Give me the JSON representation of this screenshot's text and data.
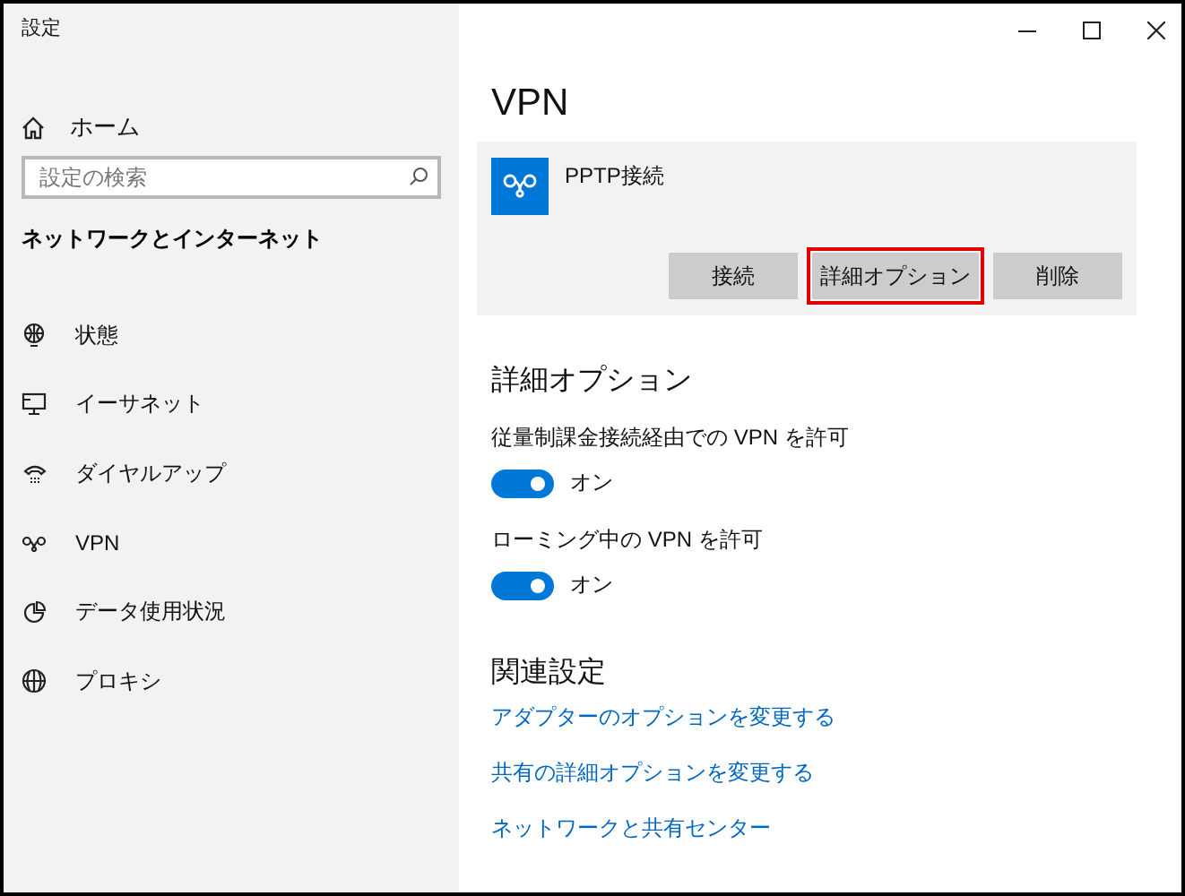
{
  "window": {
    "title": "設定"
  },
  "sidebar": {
    "home": "ホーム",
    "search": {
      "placeholder": "設定の検索"
    },
    "section": "ネットワークとインターネット",
    "items": [
      {
        "label": "状態"
      },
      {
        "label": "イーサネット"
      },
      {
        "label": "ダイヤルアップ"
      },
      {
        "label": "VPN"
      },
      {
        "label": "データ使用状況"
      },
      {
        "label": "プロキシ"
      }
    ]
  },
  "page": {
    "title": "VPN",
    "connection": {
      "name": "PPTP接続",
      "buttons": [
        {
          "label": "接続",
          "highlighted": false
        },
        {
          "label": "詳細オプション",
          "highlighted": true
        },
        {
          "label": "削除",
          "highlighted": false
        }
      ]
    },
    "advanced": {
      "heading": "詳細オプション",
      "settings": [
        {
          "label": "従量制課金接続経由での VPN を許可",
          "on": true,
          "state": "オン"
        },
        {
          "label": "ローミング中の VPN を許可",
          "on": true,
          "state": "オン"
        }
      ]
    },
    "related": {
      "heading": "関連設定",
      "links": [
        "アダプターのオプションを変更する",
        "共有の詳細オプションを変更する",
        "ネットワークと共有センター"
      ]
    }
  }
}
